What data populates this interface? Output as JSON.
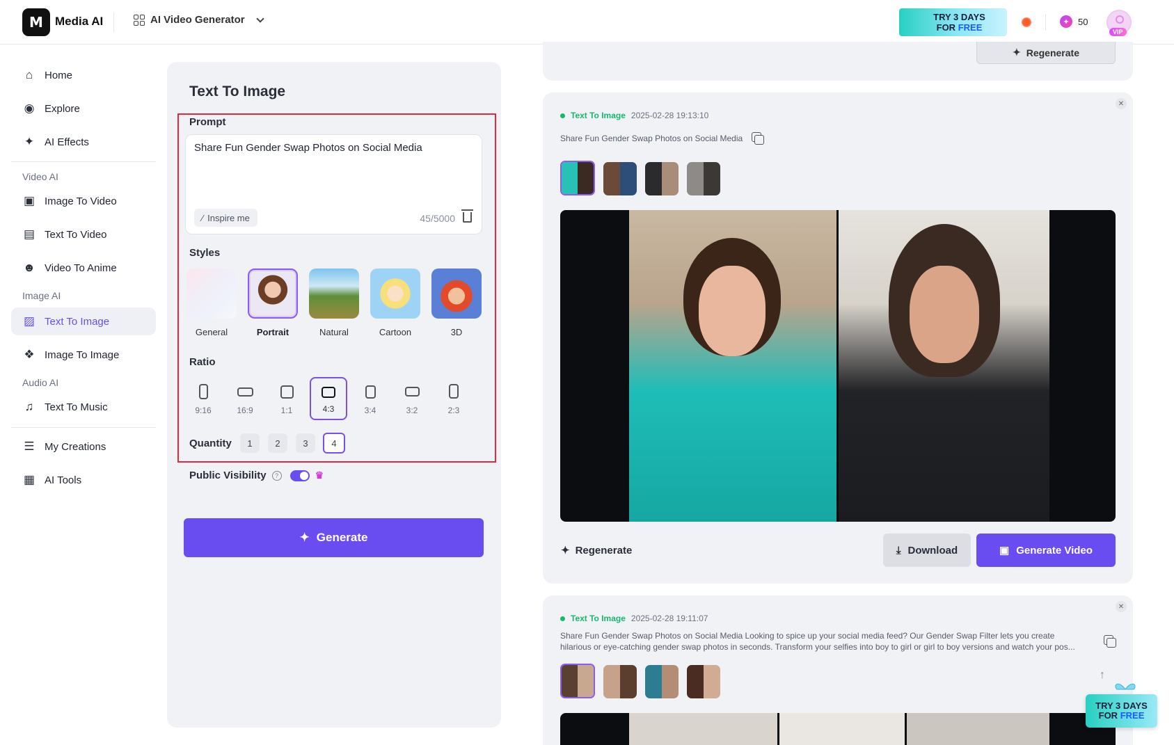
{
  "header": {
    "logo_text": "M",
    "brand": "Media AI",
    "tool_switch": "AI Video Generator",
    "promo_line1": "TRY 3 DAYS",
    "promo_line2a": "FOR ",
    "promo_line2b": "FREE",
    "credits": "50",
    "vip_badge": "VIP"
  },
  "sidebar": {
    "home": "Home",
    "explore": "Explore",
    "ai_effects": "AI Effects",
    "section_video": "Video AI",
    "image_to_video": "Image To Video",
    "text_to_video": "Text To Video",
    "video_to_anime": "Video To Anime",
    "section_image": "Image AI",
    "text_to_image": "Text To Image",
    "image_to_image": "Image To Image",
    "section_audio": "Audio AI",
    "text_to_music": "Text To Music",
    "my_creations": "My Creations",
    "ai_tools": "AI Tools"
  },
  "form": {
    "title": "Text To Image",
    "prompt_label": "Prompt",
    "prompt_value": "Share Fun Gender Swap Photos on Social Media",
    "inspire": "Inspire me",
    "count": "45/5000",
    "styles_label": "Styles",
    "styles": [
      "General",
      "Portrait",
      "Natural",
      "Cartoon",
      "3D"
    ],
    "selected_style": "Portrait",
    "ratio_label": "Ratio",
    "ratios": [
      "9:16",
      "16:9",
      "1:1",
      "4:3",
      "3:4",
      "3:2",
      "2:3"
    ],
    "selected_ratio": "4:3",
    "quantity_label": "Quantity",
    "quantities": [
      "1",
      "2",
      "3",
      "4"
    ],
    "selected_quantity": "4",
    "visibility_label": "Public Visibility",
    "visibility_on": true,
    "generate": "Generate"
  },
  "results": {
    "top_regenerate": "Regenerate",
    "card1": {
      "type": "Text To Image",
      "time": "2025-02-28 19:13:10",
      "prompt": "Share Fun Gender Swap Photos on Social Media",
      "regenerate": "Regenerate",
      "download": "Download",
      "generate_video": "Generate Video"
    },
    "card2": {
      "type": "Text To Image",
      "time": "2025-02-28 19:11:07",
      "prompt_line1": "Share Fun Gender Swap Photos on Social Media Looking to spice up your social media feed? Our Gender Swap Filter lets you create",
      "prompt_line2": "hilarious or eye-catching gender swap photos in seconds. Transform your selfies into boy to girl or girl to boy versions and watch your pos..."
    }
  },
  "float_promo": {
    "line1": "TRY 3 DAYS",
    "line2a": "FOR ",
    "line2b": "FREE"
  },
  "colors": {
    "accent": "#6a4df0",
    "status_green": "#16b96a",
    "highlight_red": "#e0283e"
  }
}
